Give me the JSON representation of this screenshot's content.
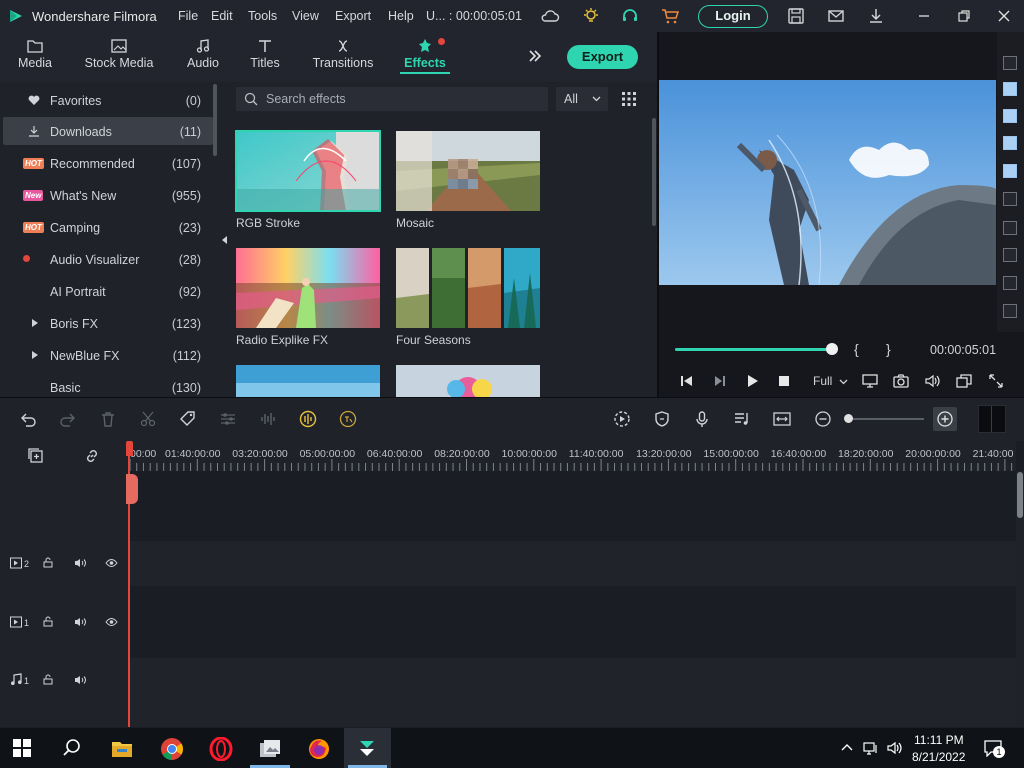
{
  "titlebar": {
    "app_title": "Wondershare Filmora",
    "menus": [
      "File",
      "Edit",
      "Tools",
      "View",
      "Export",
      "Help"
    ],
    "project_time": "U... : 00:00:05:01",
    "login_label": "Login"
  },
  "modules": {
    "tabs": [
      {
        "label": "Media",
        "icon": "folder-icon"
      },
      {
        "label": "Stock Media",
        "icon": "image-icon"
      },
      {
        "label": "Audio",
        "icon": "music-note-icon"
      },
      {
        "label": "Titles",
        "icon": "text-icon"
      },
      {
        "label": "Transitions",
        "icon": "transition-icon"
      },
      {
        "label": "Effects",
        "icon": "effects-icon",
        "active": true
      }
    ],
    "export_label": "Export"
  },
  "sidebar": {
    "items": [
      {
        "label": "Favorites",
        "count": "(0)",
        "icon": "heart-icon"
      },
      {
        "label": "Downloads",
        "count": "(11)",
        "icon": "download-icon",
        "selected": true
      },
      {
        "label": "Recommended",
        "count": "(107)",
        "badge": "HOT"
      },
      {
        "label": "What's New",
        "count": "(955)",
        "badge": "New"
      },
      {
        "label": "Camping",
        "count": "(23)",
        "badge": "HOT"
      },
      {
        "label": "Audio Visualizer",
        "count": "(28)",
        "icon": "red-dot-icon"
      },
      {
        "label": "AI Portrait",
        "count": "(92)"
      },
      {
        "label": "Boris FX",
        "count": "(123)",
        "expandable": true
      },
      {
        "label": "NewBlue FX",
        "count": "(112)",
        "expandable": true
      },
      {
        "label": "Basic",
        "count": "(130)"
      }
    ]
  },
  "browser": {
    "search_placeholder": "Search effects",
    "filter_value": "All",
    "effects": [
      {
        "label": "RGB Stroke"
      },
      {
        "label": "Mosaic"
      },
      {
        "label": "Radio Explike FX"
      },
      {
        "label": "Four Seasons"
      }
    ]
  },
  "preview": {
    "timecode": "00:00:05:01",
    "bracket_in": "{",
    "bracket_out": "}",
    "quality": "Full",
    "progress": 1.0
  },
  "timeline": {
    "ruler_labels": [
      "00:00",
      "01:40:00:00",
      "03:20:00:00",
      "05:00:00:00",
      "06:40:00:00",
      "08:20:00:00",
      "10:00:00:00",
      "11:40:00:00",
      "13:20:00:00",
      "15:00:00:00",
      "16:40:00:00",
      "18:20:00:00",
      "20:00:00:00",
      "21:40:00"
    ],
    "tracks": [
      {
        "id": "2",
        "kind": "video"
      },
      {
        "id": "1",
        "kind": "video"
      },
      {
        "id": "1",
        "kind": "audio"
      }
    ]
  },
  "taskbar": {
    "time": "11:11 PM",
    "date": "8/21/2022",
    "notification_count": "1"
  },
  "colors": {
    "accent": "#2fd5b0",
    "playhead": "#e2463c",
    "panel": "#1f2229"
  }
}
